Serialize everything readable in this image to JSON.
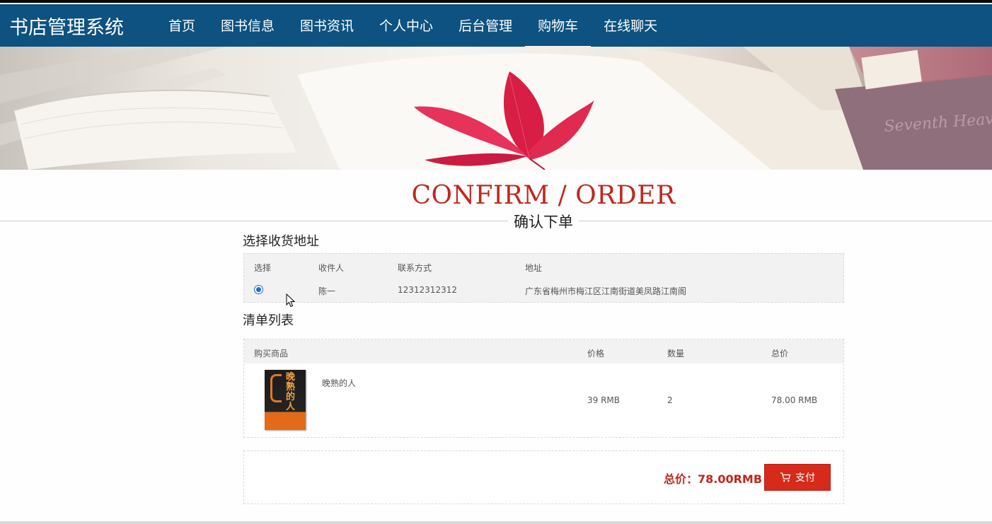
{
  "header": {
    "brand": "书店管理系统",
    "nav": [
      "首页",
      "图书信息",
      "图书资讯",
      "个人中心",
      "后台管理",
      "购物车",
      "在线聊天"
    ],
    "active_nav": "购物车"
  },
  "page": {
    "title_en": "CONFIRM / ORDER",
    "title_cn": "确认下单"
  },
  "address_section": {
    "heading": "选择收货地址",
    "columns": [
      "选择",
      "收件人",
      "联系方式",
      "地址"
    ],
    "rows": [
      {
        "selected": true,
        "recipient": "陈一",
        "phone": "12312312312",
        "address": "广东省梅州市梅江区江南街道美凤路江南阁"
      }
    ]
  },
  "list_section": {
    "heading": "清单列表",
    "columns": [
      "购买商品",
      "价格",
      "数量",
      "总价"
    ],
    "items": [
      {
        "name": "晚熟的人",
        "price": "39 RMB",
        "quantity": "2",
        "subtotal": "78.00 RMB",
        "cover_text": "晚熟的人"
      }
    ]
  },
  "footer": {
    "total_label": "总价：78.00RMB",
    "pay_label": "支付",
    "pay_icon": "cart-icon"
  },
  "colors": {
    "nav_bg": "#0d5280",
    "accent_red": "#c0271d",
    "pay_button": "#d62b1a"
  }
}
